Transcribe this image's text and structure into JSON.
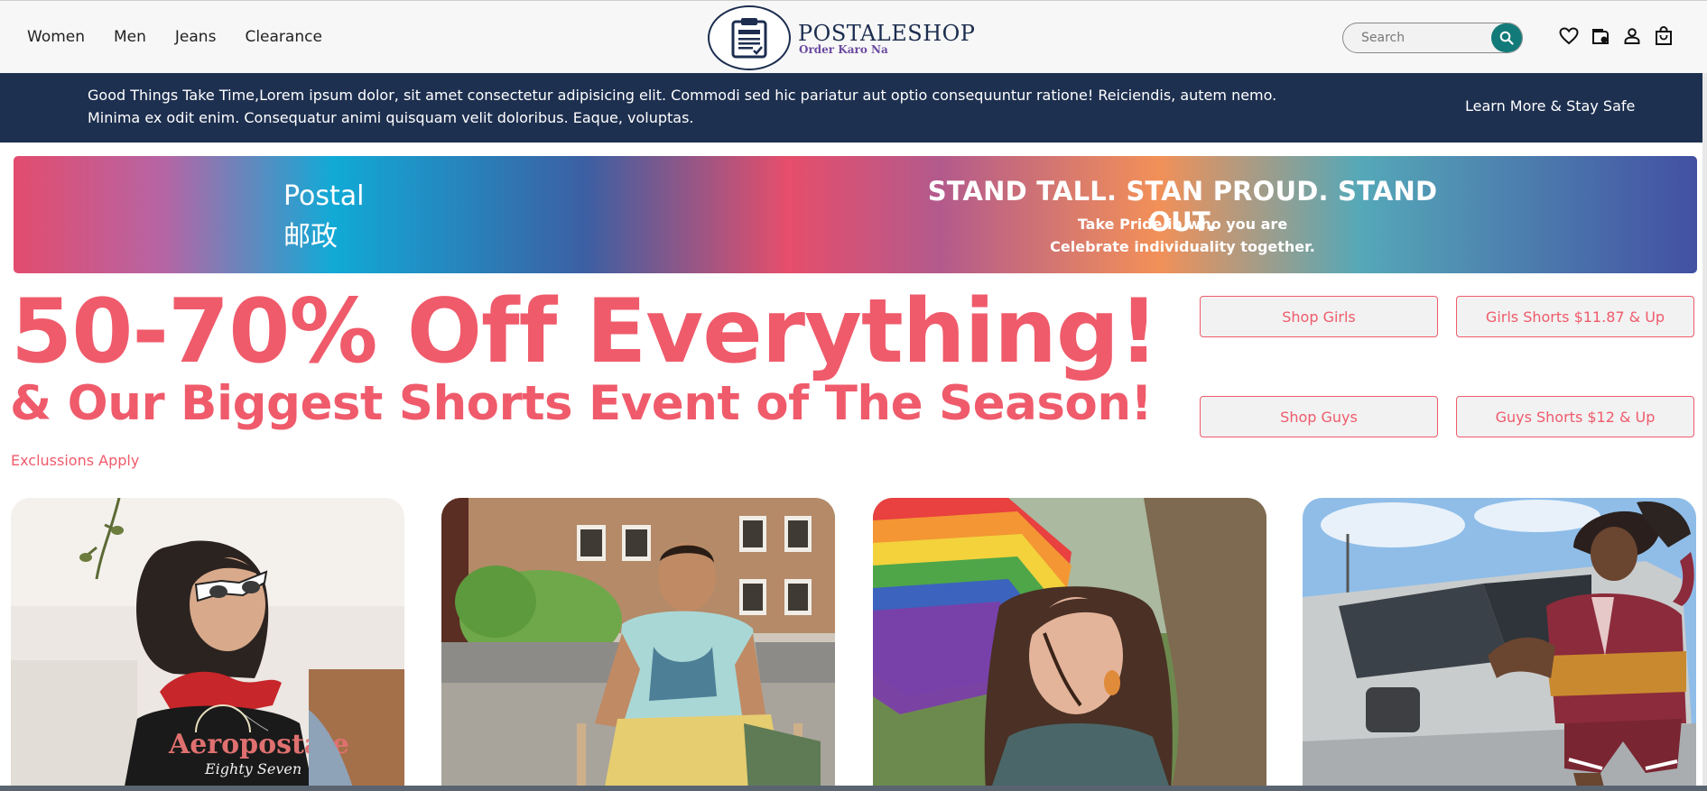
{
  "header": {
    "nav": [
      "Women",
      "Men",
      "Jeans",
      "Clearance"
    ],
    "logo_name": "POSTALESHOP",
    "logo_tagline": "Order Karo Na",
    "search_placeholder": "Search",
    "icons": [
      "heart-icon",
      "gift-card-icon",
      "user-icon",
      "shopping-bag-icon"
    ]
  },
  "announcement": {
    "text": "Good Things Take Time,Lorem ipsum dolor, sit amet consectetur adipisicing elit. Commodi sed hic pariatur aut optio consequuntur ratione! Reiciendis, autem nemo. Minima ex odit enim. Consequatur animi quisquam velit doloribus. Eaque, voluptas.",
    "link": "Learn More & Stay Safe"
  },
  "banner": {
    "left_line1": "Postal",
    "left_line2": "邮政",
    "title": "STAND TALL. STAN PROUD. STAND OUT.",
    "sub_line1": "Take Pride in who you are",
    "sub_line2": "Celebrate individuality together."
  },
  "promo": {
    "headline": "50-70% Off Everything!",
    "subheadline": "& Our Biggest Shorts Event of The Season!",
    "note": "Exclussions Apply",
    "buttons": [
      "Shop Girls",
      "Girls Shorts $11.87 & Up",
      "Shop Guys",
      "Guys Shorts $12 & Up"
    ]
  },
  "cards": {
    "shirt_text_line1": "Aeropostale",
    "shirt_text_line2": "Eighty Seven"
  },
  "colors": {
    "accent": "#ef5b6b",
    "navy": "#1e3050",
    "teal": "#127a78",
    "header_bg": "#f7f7f7"
  }
}
